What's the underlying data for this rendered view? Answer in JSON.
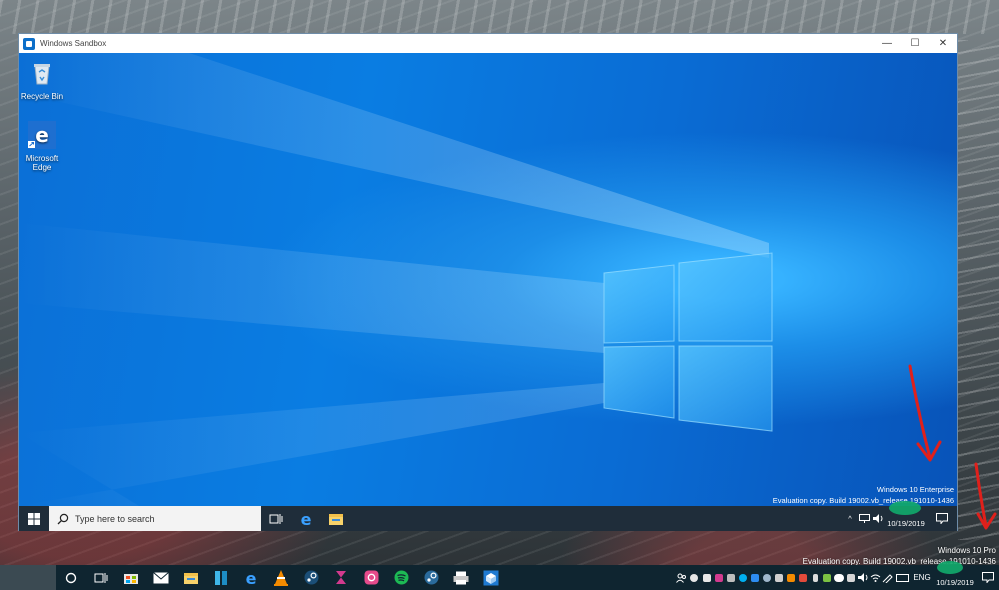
{
  "sandbox": {
    "window_title": "Windows Sandbox",
    "controls": {
      "minimize": "—",
      "maximize": "☐",
      "close": "✕"
    },
    "desktop_icons": [
      {
        "label_line1": "Recycle Bin",
        "label_line2": ""
      },
      {
        "label_line1": "Microsoft",
        "label_line2": "Edge"
      }
    ],
    "watermark": {
      "line1": "Windows 10 Enterprise",
      "line2": "Evaluation copy. Build 19002.vb_release.191010-1436"
    },
    "taskbar": {
      "search_placeholder": "Type here to search",
      "tray_chevron": "^",
      "clock_date": "10/19/2019"
    },
    "colors": {
      "desktop_blue": "#0a7de2",
      "taskbar": "#1f2d3a"
    }
  },
  "host": {
    "watermark": {
      "line1": "Windows 10 Pro",
      "line2": "Evaluation copy. Build 19002.vb_release.191010-1436"
    },
    "taskbar": {
      "language": "ENG",
      "clock_date": "10/19/2019",
      "pinned_icons": [
        "cortana-icon",
        "task-view-icon",
        "store-icon",
        "mail-icon",
        "file-explorer-icon",
        "app-icon",
        "edge-icon",
        "vlc-icon",
        "steam-icon",
        "hourglass-icon",
        "instagram-icon",
        "spotify-icon",
        "steam-alt-icon",
        "printer-icon",
        "sandbox-icon"
      ]
    },
    "colors": {
      "taskbar": "#0f2530",
      "annotation_red": "#e0201b",
      "redaction_green": "#11a86b"
    }
  }
}
